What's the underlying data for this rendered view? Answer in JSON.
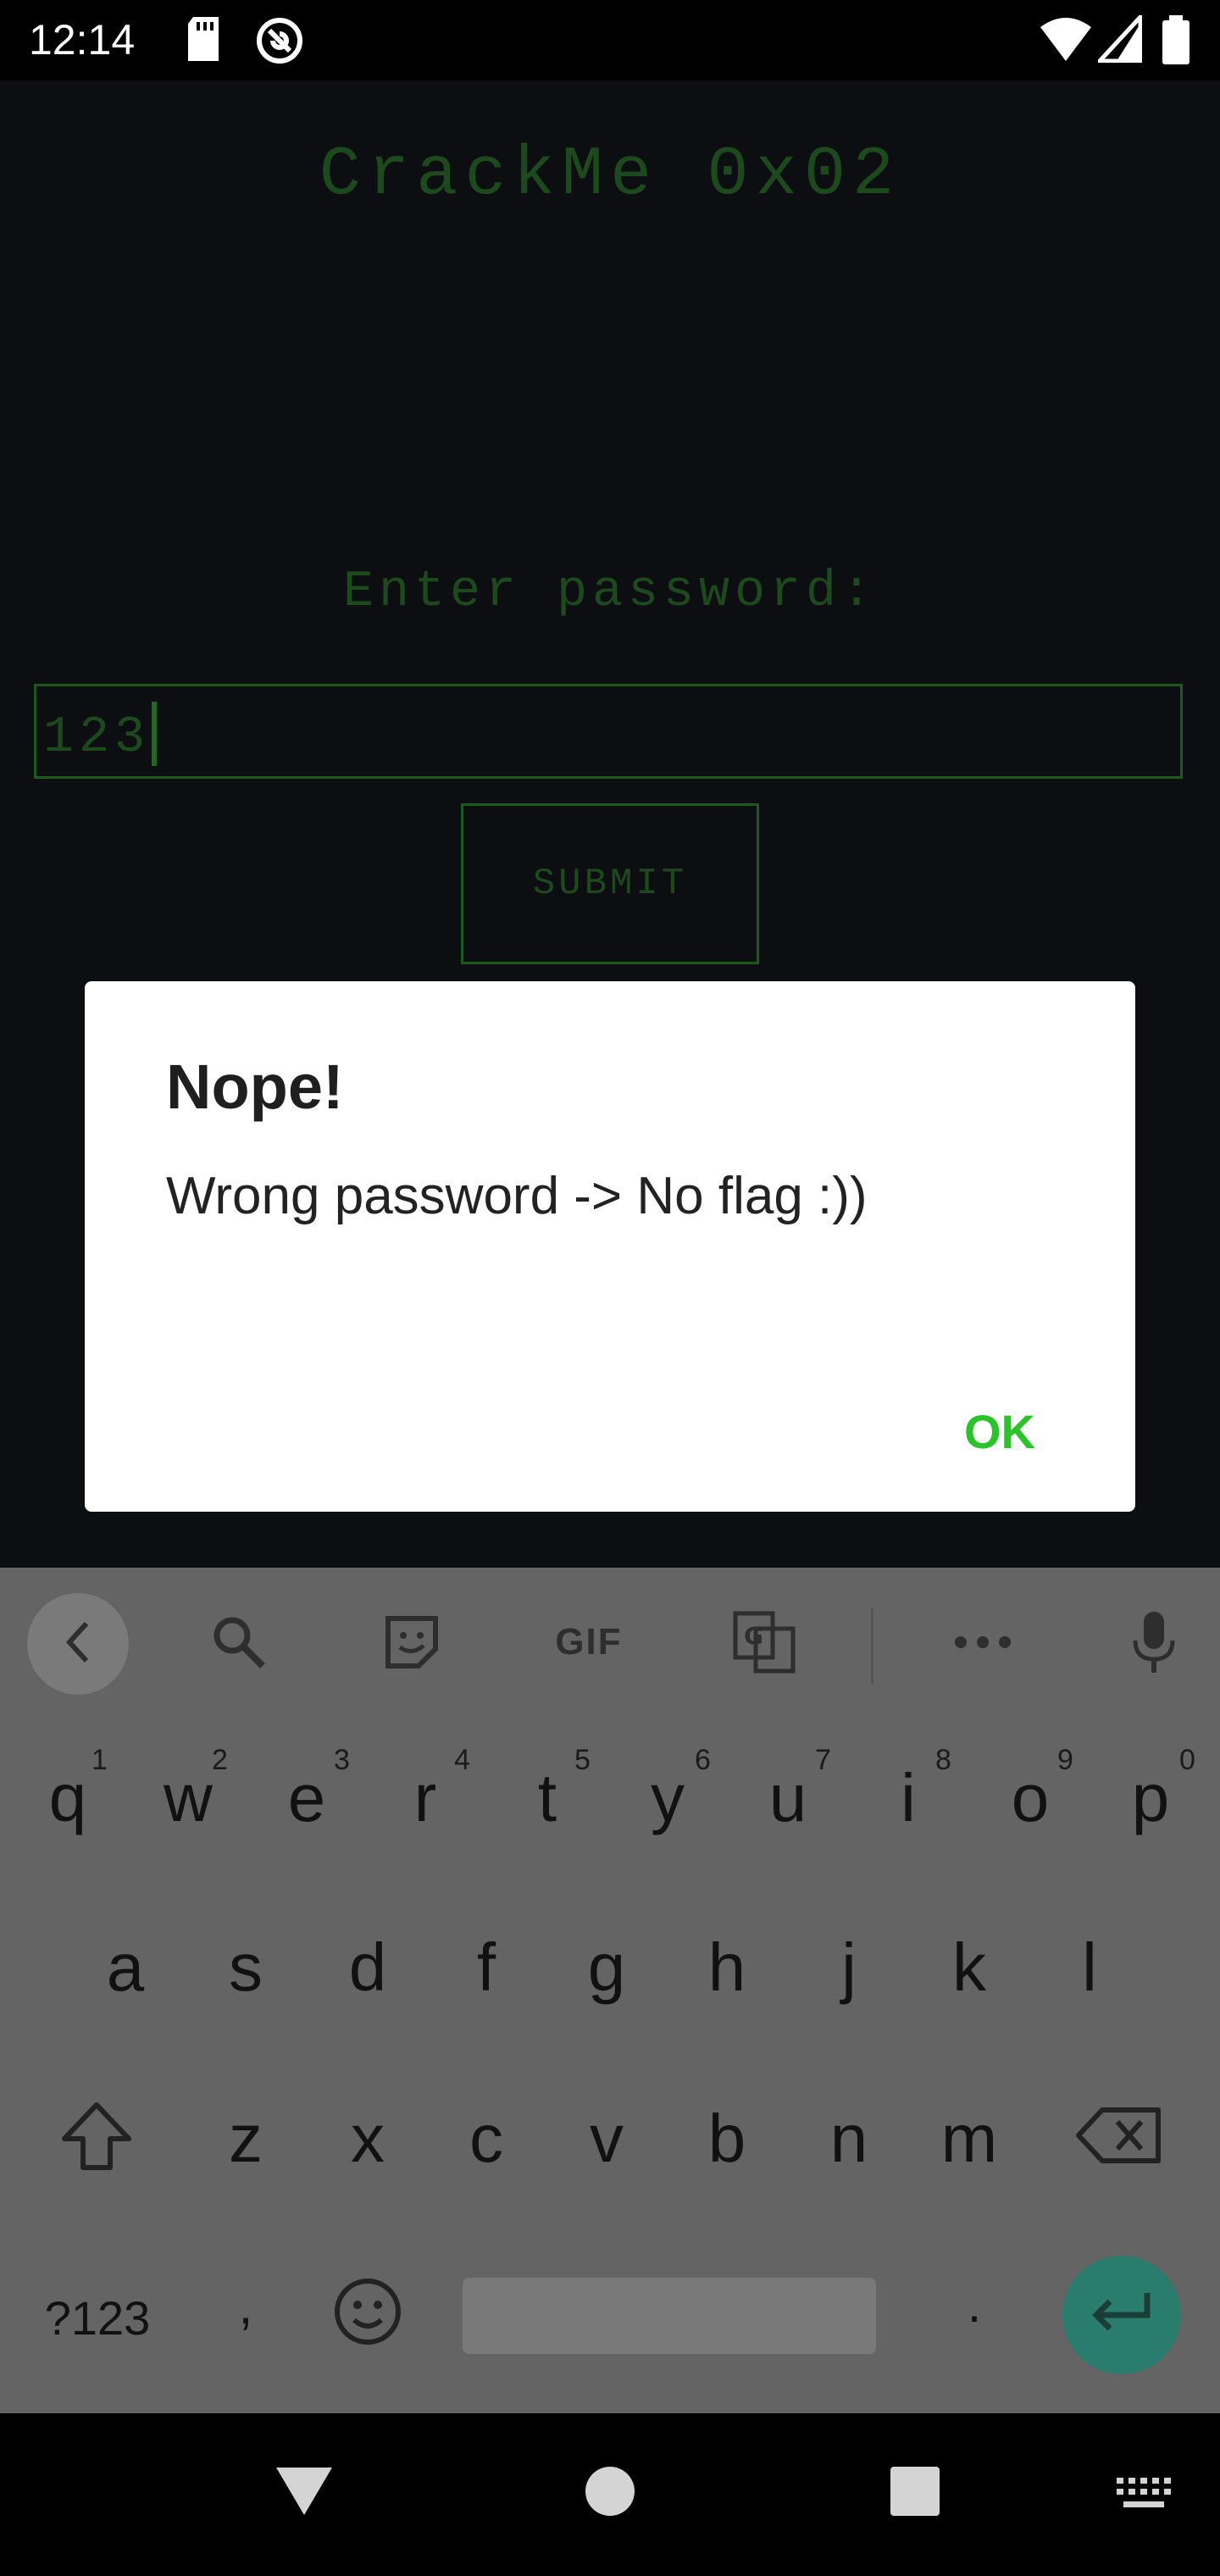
{
  "status": {
    "time": "12:14"
  },
  "app": {
    "title": "CrackMe 0x02",
    "prompt": "Enter password:",
    "password_value": "123",
    "submit_label": "SUBMIT"
  },
  "dialog": {
    "title": "Nope!",
    "message": "Wrong password -> No flag :))",
    "ok_label": "OK"
  },
  "keyboard": {
    "toolbar": [
      "back-icon",
      "search-icon",
      "sticker-icon",
      "GIF",
      "translate-icon",
      "more-icon",
      "mic-icon"
    ],
    "gif_label": "GIF",
    "row1": [
      {
        "k": "q",
        "n": "1"
      },
      {
        "k": "w",
        "n": "2"
      },
      {
        "k": "e",
        "n": "3"
      },
      {
        "k": "r",
        "n": "4"
      },
      {
        "k": "t",
        "n": "5"
      },
      {
        "k": "y",
        "n": "6"
      },
      {
        "k": "u",
        "n": "7"
      },
      {
        "k": "i",
        "n": "8"
      },
      {
        "k": "o",
        "n": "9"
      },
      {
        "k": "p",
        "n": "0"
      }
    ],
    "row2": [
      "a",
      "s",
      "d",
      "f",
      "g",
      "h",
      "j",
      "k",
      "l"
    ],
    "row3": [
      "z",
      "x",
      "c",
      "v",
      "b",
      "n",
      "m"
    ],
    "symbols_label": "?123",
    "comma": ",",
    "period": "."
  },
  "colors": {
    "terminal_green": "#1c4a1c",
    "ok_green": "#28c428",
    "enter_teal": "#2a7c6c"
  }
}
